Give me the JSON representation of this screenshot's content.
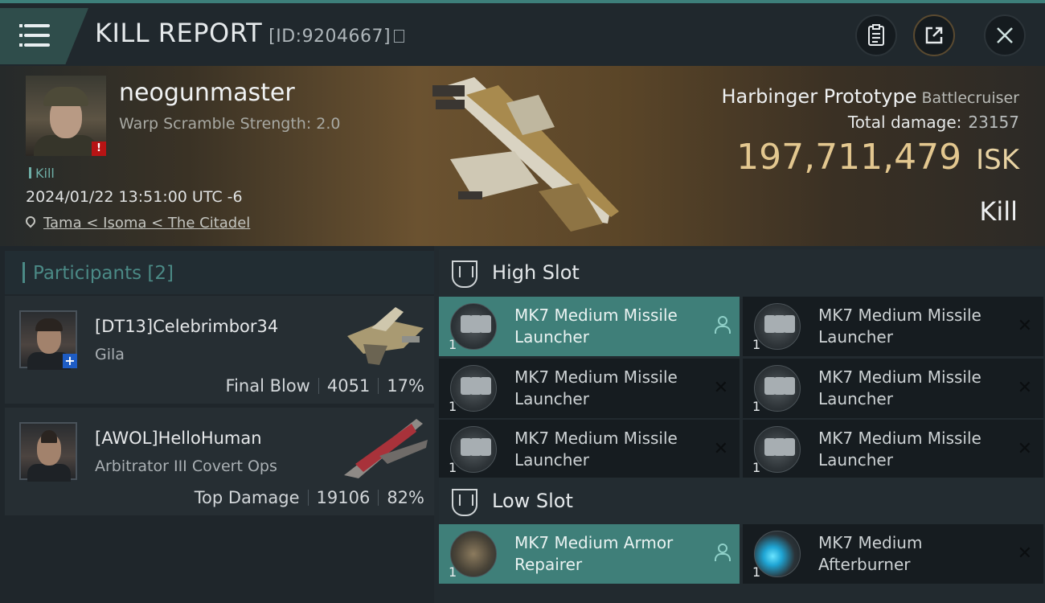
{
  "header": {
    "title": "KILL REPORT",
    "report_id": "[ID:9204667]",
    "icons": [
      "menu-icon",
      "copy-icon",
      "clipboard-icon",
      "share-icon",
      "close-icon"
    ]
  },
  "victim": {
    "name": "neogunmaster",
    "warp_scramble": "Warp Scramble Strength: 2.0",
    "tag": "Kill",
    "datetime": "2024/01/22 13:51:00 UTC -6",
    "location": "Tama < Isoma < The Citadel",
    "ship_name": "Harbinger Prototype",
    "ship_class": "Battlecruiser",
    "total_damage_label": "Total damage:",
    "total_damage": "23157",
    "isk_value": "197,711,479",
    "isk_unit": "ISK",
    "result": "Kill"
  },
  "participants": {
    "title": "Participants [2]",
    "items": [
      {
        "name": "[DT13]Celebrimbor34",
        "ship": "Gila",
        "role": "Final Blow",
        "damage": "4051",
        "percent": "17%"
      },
      {
        "name": "[AWOL]HelloHuman",
        "ship": "Arbitrator III Covert Ops",
        "role": "Top Damage",
        "damage": "19106",
        "percent": "82%"
      }
    ]
  },
  "high_slot": {
    "title": "High Slot",
    "modules": [
      {
        "l1": "MK7 Medium Missile",
        "l2": "Launcher",
        "qty": "1"
      },
      {
        "l1": "MK7 Medium Missile",
        "l2": "Launcher",
        "qty": "1"
      },
      {
        "l1": "MK7 Medium Missile",
        "l2": "Launcher",
        "qty": "1"
      },
      {
        "l1": "MK7 Medium Missile",
        "l2": "Launcher",
        "qty": "1"
      },
      {
        "l1": "MK7 Medium Missile",
        "l2": "Launcher",
        "qty": "1"
      },
      {
        "l1": "MK7 Medium Missile",
        "l2": "Launcher",
        "qty": "1"
      }
    ]
  },
  "low_slot": {
    "title": "Low Slot",
    "modules": [
      {
        "l1": "MK7 Medium Armor",
        "l2": "Repairer",
        "qty": "1"
      },
      {
        "l1": "MK7 Medium",
        "l2": "Afterburner",
        "qty": "1"
      }
    ]
  },
  "colors": {
    "accent": "#3f7f79",
    "isk": "#e3c78f",
    "alert": "#b71414"
  }
}
